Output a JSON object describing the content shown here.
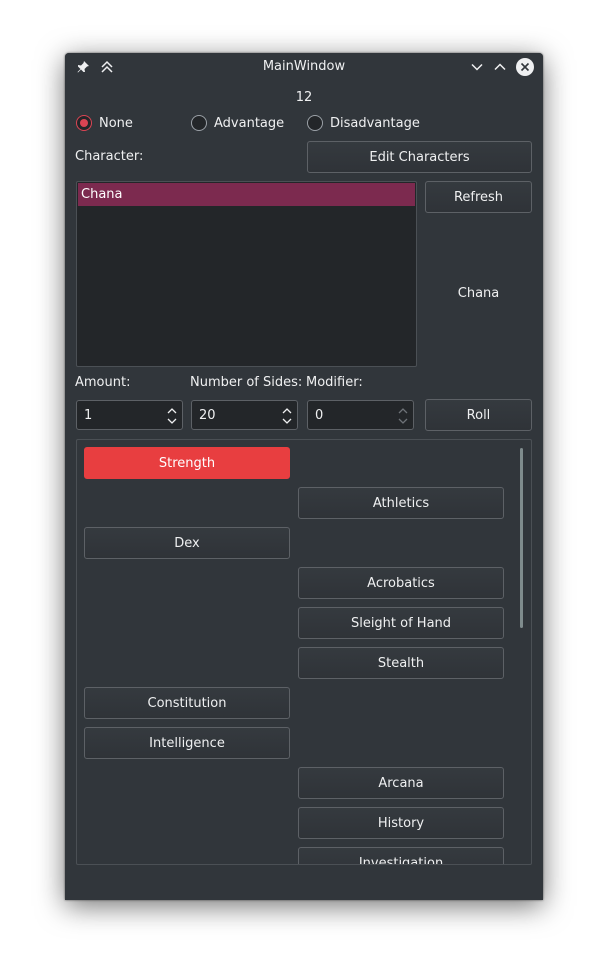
{
  "window": {
    "title": "MainWindow"
  },
  "counter": "12",
  "roll_mode": {
    "options": [
      "None",
      "Advantage",
      "Disadvantage"
    ],
    "selected": "None"
  },
  "character_label": "Character:",
  "edit_characters_button": "Edit Characters",
  "refresh_button": "Refresh",
  "characters": [
    "Chana"
  ],
  "selected_character_name": "Chana",
  "dice": {
    "amount_label": "Amount:",
    "sides_label": "Number of Sides:",
    "modifier_label": "Modifier:",
    "amount": "1",
    "sides": "20",
    "modifier": "0",
    "roll_button": "Roll"
  },
  "skills": [
    {
      "label": "Strength",
      "column": "left",
      "active": true
    },
    {
      "label": "Athletics",
      "column": "right"
    },
    {
      "label": "Dex",
      "column": "left"
    },
    {
      "label": "Acrobatics",
      "column": "right"
    },
    {
      "label": "Sleight of Hand",
      "column": "right"
    },
    {
      "label": "Stealth",
      "column": "right"
    },
    {
      "label": "Constitution",
      "column": "left"
    },
    {
      "label": "Intelligence",
      "column": "left"
    },
    {
      "label": "Arcana",
      "column": "right"
    },
    {
      "label": "History",
      "column": "right"
    },
    {
      "label": "Investigation",
      "column": "right"
    }
  ],
  "colors": {
    "window_bg": "#31363b",
    "accent": "#e83e40",
    "selection": "#7c2a4f",
    "radio_checked": "#da4453"
  }
}
